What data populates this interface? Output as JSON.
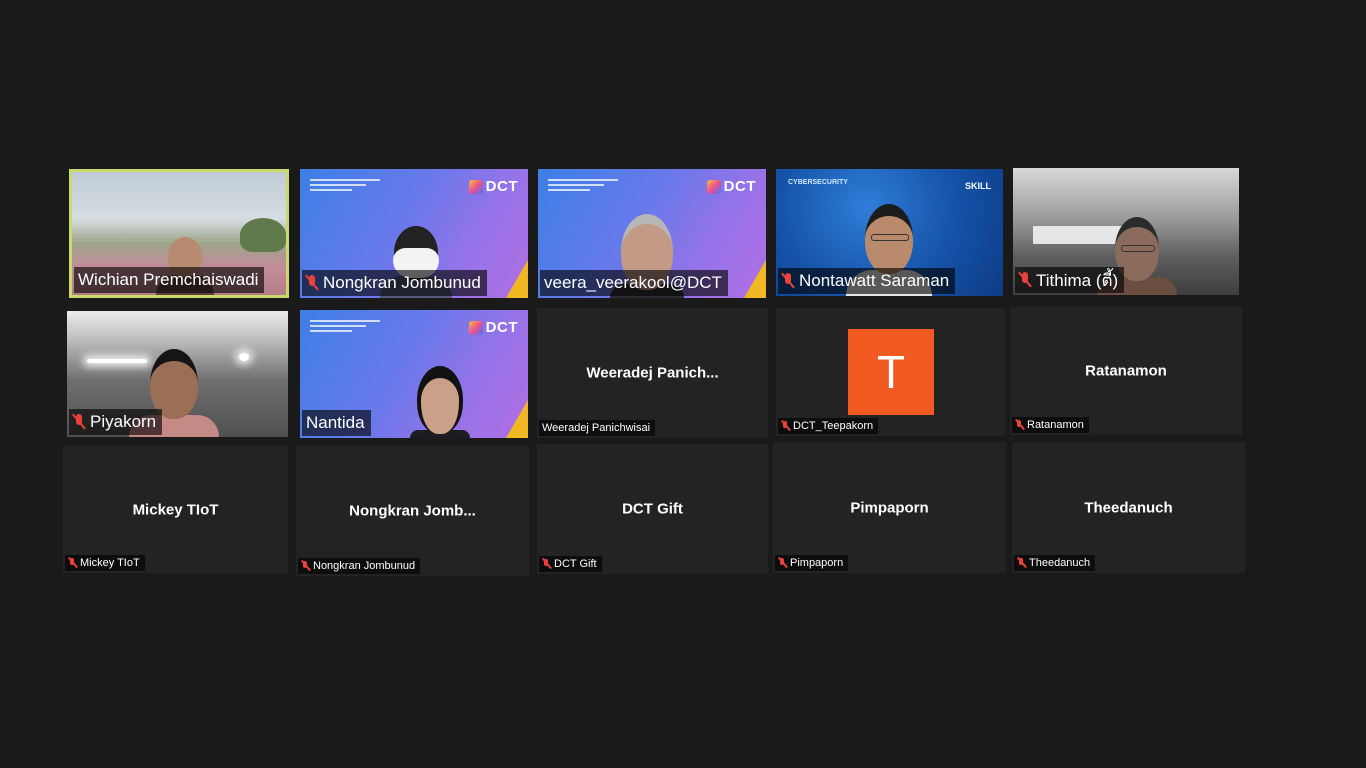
{
  "window": {
    "background": "#1a1a1a"
  },
  "participants": [
    {
      "name": "Wichian Premchaiswadi",
      "muted": false,
      "active_speaker": true
    },
    {
      "name": "Nongkran Jombunud",
      "muted": true
    },
    {
      "name": "veera_veerakool@DCT",
      "muted": false
    },
    {
      "name": "Nontawatt Saraman",
      "muted": true
    },
    {
      "name": "Tithima (ตี้)",
      "muted": true
    },
    {
      "name": "Piyakorn",
      "muted": true
    },
    {
      "name": "Nantida",
      "muted": false
    },
    {
      "center_label": "Weeradej  Panich...",
      "name": "Weeradej Panichwisai",
      "muted": false
    },
    {
      "avatar_letter": "T",
      "name": "DCT_Teepakorn",
      "muted": true
    },
    {
      "center_label": "Ratanamon",
      "name": "Ratanamon",
      "muted": true
    },
    {
      "center_label": "Mickey TIoT",
      "name": "Mickey TIoT",
      "muted": true
    },
    {
      "center_label": "Nongkran  Jomb...",
      "name": "Nongkran Jombunud",
      "muted": true
    },
    {
      "center_label": "DCT Gift",
      "name": "DCT Gift",
      "muted": true
    },
    {
      "center_label": "Pimpaporn",
      "name": "Pimpaporn",
      "muted": true
    },
    {
      "center_label": "Theedanuch",
      "name": "Theedanuch",
      "muted": true
    }
  ],
  "branding": {
    "dct_logo": "DCT",
    "skill_logo": "SKILL",
    "cyber_text": "CYBERSECURITY"
  },
  "colors": {
    "active_border": "#c9d96b",
    "muted_icon": "#e8423a",
    "avatar_bg": "#f15b22"
  },
  "icons": {
    "muted": "mic-off-icon"
  }
}
